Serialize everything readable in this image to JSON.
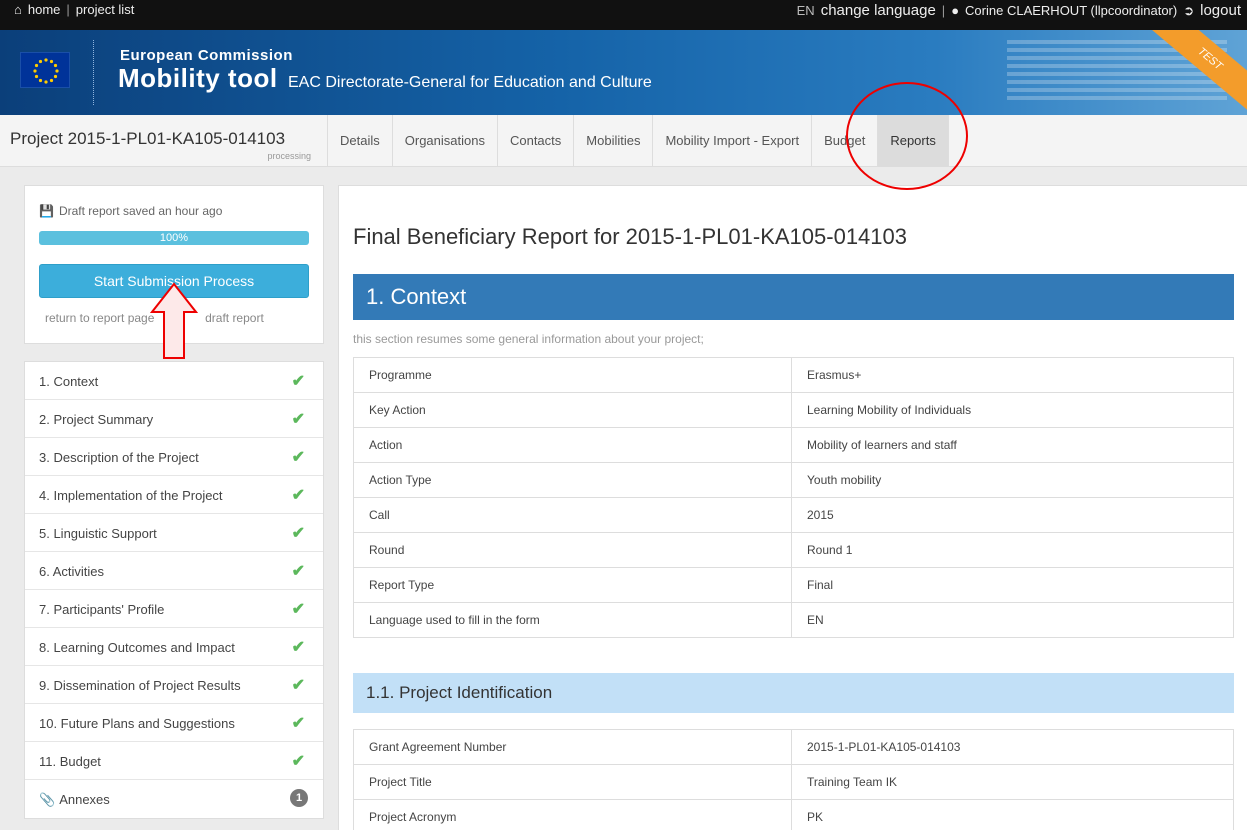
{
  "topbar": {
    "home": "home",
    "separator": "|",
    "project_list": "project list",
    "lang_code": "EN",
    "change_language": "change language",
    "user": "Corine CLAERHOUT (llpcoordinator)",
    "logout": "logout"
  },
  "header": {
    "org": "European Commission",
    "app": "Mobility tool",
    "dg": "EAC Directorate-General for Education and Culture",
    "ribbon": "TEST"
  },
  "nav": {
    "project_code": "Project 2015-1-PL01-KA105-014103",
    "project_status": "processing",
    "tabs": [
      {
        "label": "Details"
      },
      {
        "label": "Organisations"
      },
      {
        "label": "Contacts"
      },
      {
        "label": "Mobilities"
      },
      {
        "label": "Mobility Import - Export"
      },
      {
        "label": "Budget"
      },
      {
        "label": "Reports"
      }
    ]
  },
  "submission": {
    "draft_saved": "Draft report saved an hour ago",
    "progress_value": 100,
    "progress_label": "100%",
    "submit_button": "Start Submission Process",
    "return_link": "return to report page",
    "draft_link": "draft report"
  },
  "menu": {
    "items": [
      {
        "label": "1. Context"
      },
      {
        "label": "2. Project Summary"
      },
      {
        "label": "3. Description of the Project"
      },
      {
        "label": "4. Implementation of the Project"
      },
      {
        "label": "5. Linguistic Support"
      },
      {
        "label": "6. Activities"
      },
      {
        "label": "7. Participants' Profile"
      },
      {
        "label": "8. Learning Outcomes and Impact"
      },
      {
        "label": "9. Dissemination of Project Results"
      },
      {
        "label": "10. Future Plans and Suggestions"
      },
      {
        "label": "11. Budget"
      }
    ],
    "annexes": {
      "label": "Annexes",
      "count": "1"
    }
  },
  "main": {
    "title": "Final Beneficiary Report for 2015-1-PL01-KA105-014103",
    "context": {
      "heading": "1. Context",
      "description": "this section resumes some general information about your project;",
      "rows": [
        {
          "key": "Programme",
          "value": "Erasmus+"
        },
        {
          "key": "Key Action",
          "value": "Learning Mobility of Individuals"
        },
        {
          "key": "Action",
          "value": "Mobility of learners and staff"
        },
        {
          "key": "Action Type",
          "value": "Youth mobility"
        },
        {
          "key": "Call",
          "value": "2015"
        },
        {
          "key": "Round",
          "value": "Round 1"
        },
        {
          "key": "Report Type",
          "value": "Final"
        },
        {
          "key": "Language used to fill in the form",
          "value": "EN"
        }
      ]
    },
    "identification": {
      "heading": "1.1. Project Identification",
      "rows": [
        {
          "key": "Grant Agreement Number",
          "value": "2015-1-PL01-KA105-014103"
        },
        {
          "key": "Project Title",
          "value": "Training Team IK"
        },
        {
          "key": "Project Acronym",
          "value": "PK"
        }
      ]
    }
  },
  "colors": {
    "accent": "#337ab7",
    "submit": "#3caedb",
    "check": "#5cb85c",
    "highlight": "#e00000"
  }
}
